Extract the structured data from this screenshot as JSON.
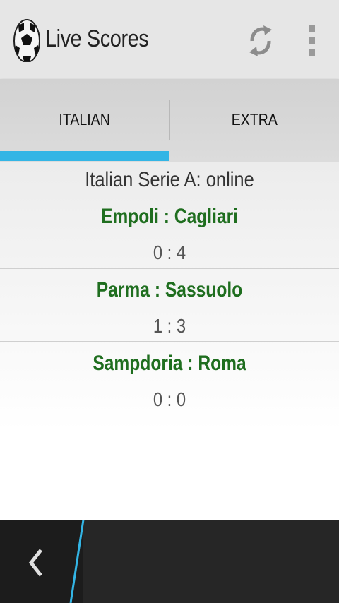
{
  "app": {
    "title": "Live Scores",
    "icon": "soccer-ball-icon"
  },
  "action_bar": {
    "refresh_icon": "refresh-icon",
    "overflow_icon": "overflow-menu-icon"
  },
  "tabs": [
    {
      "label": "ITALIAN",
      "selected": true
    },
    {
      "label": "EXTRA",
      "selected": false
    }
  ],
  "colors": {
    "accent": "#33b5e5",
    "team_text": "#1f6e1f",
    "score_text": "#555555"
  },
  "league": {
    "title": "Italian Serie A: online"
  },
  "matches": [
    {
      "teams": "Empoli : Cagliari",
      "score": "0 : 4"
    },
    {
      "teams": "Parma : Sassuolo",
      "score": "1 : 3"
    },
    {
      "teams": "Sampdoria : Roma",
      "score": "0 : 0"
    }
  ],
  "nav": {
    "back_icon": "back-chevron-icon"
  }
}
